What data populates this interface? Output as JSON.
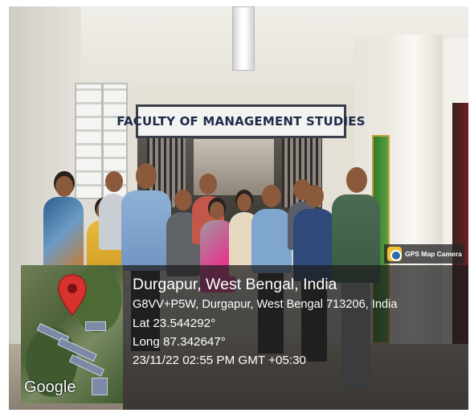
{
  "scene": {
    "sign_text": "FACULTY OF MANAGEMENT STUDIES"
  },
  "overlay": {
    "app_label": "GPS Map Camera",
    "map_brand": "Google",
    "location_title": "Durgapur, West Bengal, India",
    "address": "G8VV+P5W, Durgapur, West Bengal 713206, India",
    "latitude": "Lat 23.544292°",
    "longitude": "Long 87.342647°",
    "datetime": "23/11/22 02:55 PM GMT +05:30"
  },
  "colors": {
    "pin": "#d8322e",
    "overlay_bg": "#1c1c1c",
    "sign_text": "#1e2a4a"
  }
}
